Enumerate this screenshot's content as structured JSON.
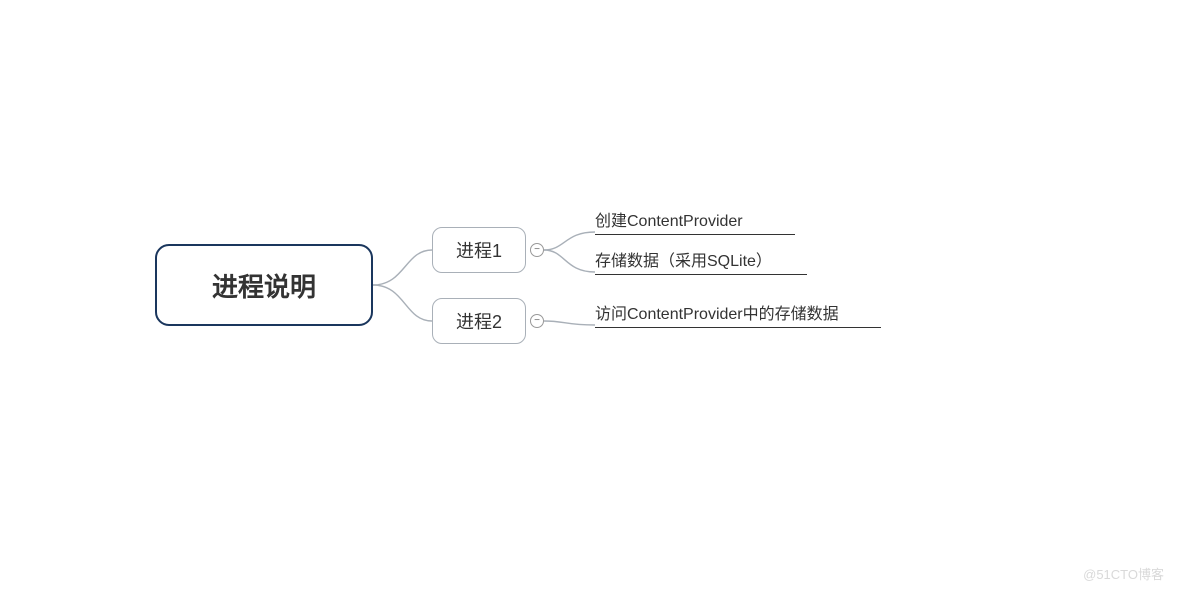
{
  "root": {
    "label": "进程说明"
  },
  "children": [
    {
      "id": "proc1",
      "label": "进程1",
      "leaves": [
        {
          "id": "leaf1",
          "text": "创建ContentProvider"
        },
        {
          "id": "leaf2",
          "text": "存储数据（采用SQLite）"
        }
      ]
    },
    {
      "id": "proc2",
      "label": "进程2",
      "leaves": [
        {
          "id": "leaf3",
          "text": "访问ContentProvider中的存储数据"
        }
      ]
    }
  ],
  "collapse_glyph": "−",
  "watermark": "@51CTO博客"
}
